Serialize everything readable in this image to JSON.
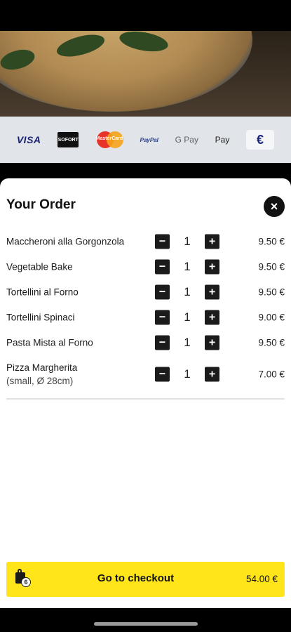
{
  "payments": {
    "methods": [
      {
        "name": "VISA",
        "icon": "visa-logo"
      },
      {
        "name": "SOFORT",
        "icon": "sofort-logo"
      },
      {
        "name": "MasterCard",
        "icon": "mastercard-logo"
      },
      {
        "name": "PayPal",
        "icon": "paypal-logo"
      },
      {
        "name": "G Pay",
        "icon": "google-pay-logo"
      },
      {
        "name": " Pay",
        "icon": "apple-pay-logo"
      }
    ],
    "currency_symbol": "€"
  },
  "order": {
    "title": "Your Order",
    "close_symbol": "×",
    "minus_symbol": "−",
    "plus_symbol": "+",
    "items": [
      {
        "name": "Maccheroni alla Gorgonzola",
        "sub": "",
        "qty": "1",
        "price": "9.50 €"
      },
      {
        "name": "Vegetable Bake",
        "sub": "",
        "qty": "1",
        "price": "9.50 €"
      },
      {
        "name": "Tortellini al Forno",
        "sub": "",
        "qty": "1",
        "price": "9.50 €"
      },
      {
        "name": "Tortellini Spinaci",
        "sub": "",
        "qty": "1",
        "price": "9.00 €"
      },
      {
        "name": "Pasta Mista al Forno",
        "sub": "",
        "qty": "1",
        "price": "9.50 €"
      },
      {
        "name": "Pizza Margherita",
        "sub": "(small, Ø 28cm)",
        "qty": "1",
        "price": "7.00 €"
      }
    ]
  },
  "checkout": {
    "label": "Go to checkout",
    "total": "54.00 €",
    "cart_count": "6"
  },
  "colors": {
    "accent": "#ffe51a",
    "button_dark": "#1b1b1b",
    "payment_bar": "#e1e4e8"
  }
}
